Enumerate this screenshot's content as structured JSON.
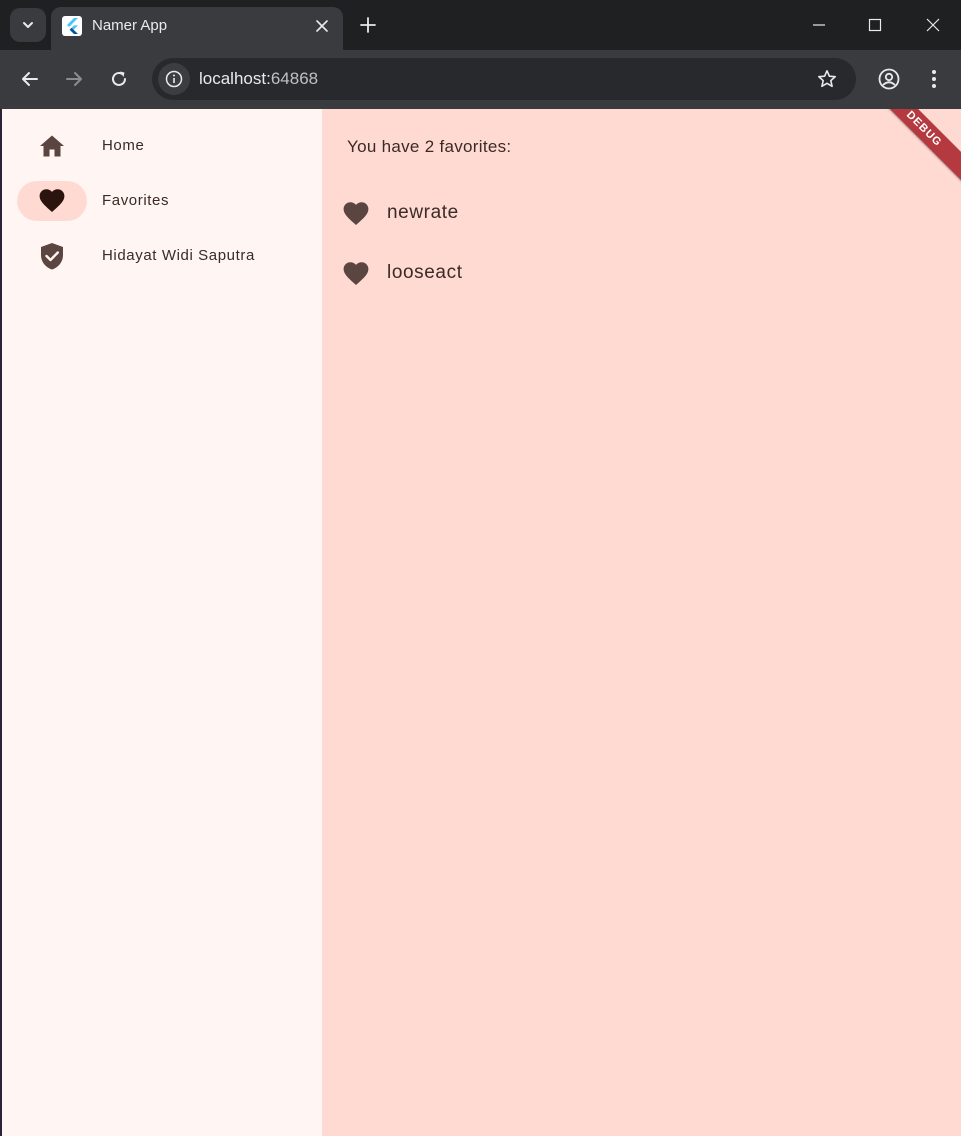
{
  "browser": {
    "tab_title": "Namer App",
    "url_host": "localhost:",
    "url_port": "64868"
  },
  "nav": {
    "items": [
      {
        "label": "Home",
        "icon": "home-icon",
        "selected": false
      },
      {
        "label": "Favorites",
        "icon": "heart-icon",
        "selected": true
      },
      {
        "label": "Hidayat Widi Saputra",
        "icon": "verified-shield-icon",
        "selected": false
      }
    ]
  },
  "favorites": {
    "count_text": "You have 2 favorites:",
    "items": [
      {
        "word": "newrate",
        "icon": "heart-icon"
      },
      {
        "word": "looseact",
        "icon": "heart-icon"
      }
    ]
  },
  "debug_banner": "DEBUG",
  "colors": {
    "rail_background": "#fff5f3",
    "content_background": "#ffdad2",
    "nav_indicator": "#ffdad2",
    "icon": "#5a4541",
    "text": "#3b2a26",
    "debug_banner": "#b43a3f"
  }
}
